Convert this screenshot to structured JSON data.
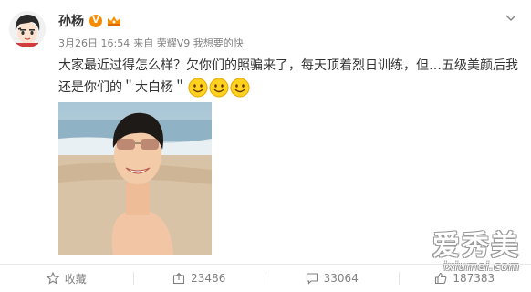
{
  "post": {
    "user_name": "孙杨",
    "verified_mark": "V",
    "time": "3月26日 16:54",
    "source": "来自 荣耀V9 我想要的快",
    "text": "大家最近过得怎么样？欠你们的照骗来了，每天顶着烈日训练，但…五级美颜后我还是你们的＂大白杨＂",
    "emoji_icons": [
      "smile-emoji-icon",
      "smile-emoji-icon",
      "smile-emoji-icon"
    ]
  },
  "actions": {
    "favorite_label": "收藏",
    "repost_count": "23486",
    "comment_count": "33064",
    "like_count": "187383"
  },
  "watermark": {
    "main": "爱秀美",
    "sub": "ixiumei.com"
  },
  "colors": {
    "accent_orange": "#f78c00",
    "meta_gray": "#808080",
    "text": "#333333"
  }
}
